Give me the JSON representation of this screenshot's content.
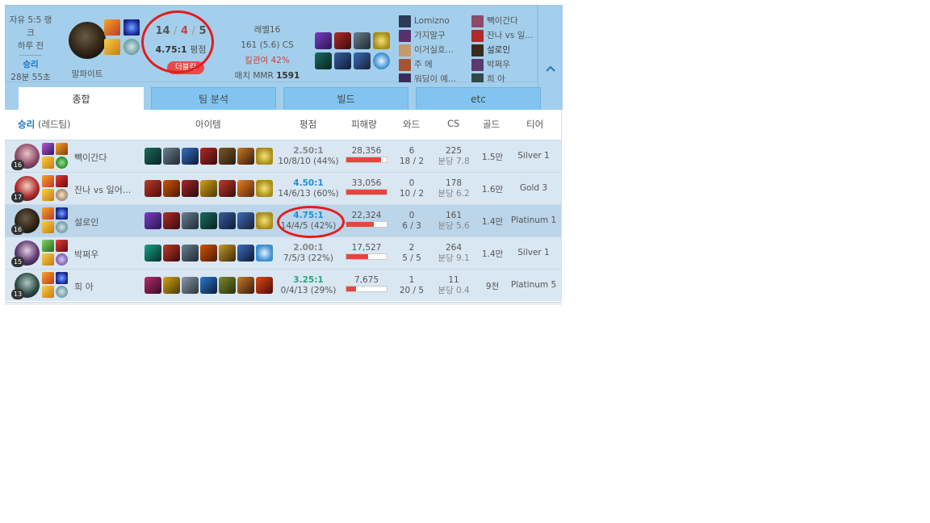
{
  "summary": {
    "queue": "자유 5:5 랭크",
    "time_ago": "하루 전",
    "result": "승리",
    "duration": "28분 55초",
    "champion": "말파이트",
    "kills": "14",
    "deaths": "4",
    "assists": "5",
    "kda_sep": "/",
    "ratio": "4.75:1",
    "ratio_suffix": "평점",
    "multikill": "더블킬",
    "level": "레벨16",
    "cs": "161 (5.6) CS",
    "kill_participation": "킬관여 42%",
    "mmr_label": "매치 MMR",
    "mmr_value": "1591"
  },
  "players_left": [
    {
      "name": "Lomizno"
    },
    {
      "name": "가지말구"
    },
    {
      "name": "이거실호..."
    },
    {
      "name": "주 에"
    },
    {
      "name": "워딩이 예..."
    }
  ],
  "players_right": [
    {
      "name": "빽이간다"
    },
    {
      "name": "잔나 vs 일..."
    },
    {
      "name": "설로인"
    },
    {
      "name": "박쩌우"
    },
    {
      "name": "희 아"
    }
  ],
  "tabs": [
    {
      "label": "종합"
    },
    {
      "label": "팀 분석"
    },
    {
      "label": "빌드"
    },
    {
      "label": "etc"
    }
  ],
  "table": {
    "team_result": "승리",
    "team_side": "(레드팀)",
    "headers": {
      "items": "아이템",
      "rating": "평점",
      "damage": "피해량",
      "ward": "와드",
      "cs": "CS",
      "gold": "골드",
      "tier": "티어"
    },
    "rows": [
      {
        "level": "16",
        "name": "빽이간다",
        "ratio": "2.50:1",
        "kda": "10/8/10 (44%)",
        "damage": "28,356",
        "damage_fraction": 0.86,
        "ward1": "6",
        "ward2": "18 / 2",
        "cs": "225",
        "cs_min": "분당 7.8",
        "gold": "1.5만",
        "tier": "Silver 1"
      },
      {
        "level": "17",
        "name": "잔나 vs 일어...",
        "ratio": "4.50:1",
        "kda": "14/6/13 (60%)",
        "damage": "33,056",
        "damage_fraction": 1.0,
        "ward1": "0",
        "ward2": "10 / 2",
        "cs": "178",
        "cs_min": "분당 6.2",
        "gold": "1.6만",
        "tier": "Gold 3"
      },
      {
        "level": "16",
        "name": "설로인",
        "ratio": "4.75:1",
        "kda": "14/4/5 (42%)",
        "damage": "22,324",
        "damage_fraction": 0.68,
        "ward1": "0",
        "ward2": "6 / 3",
        "cs": "161",
        "cs_min": "분당 5.6",
        "gold": "1.4만",
        "tier": "Platinum 1"
      },
      {
        "level": "15",
        "name": "박쩌우",
        "ratio": "2.00:1",
        "kda": "7/5/3 (22%)",
        "damage": "17,527",
        "damage_fraction": 0.53,
        "ward1": "2",
        "ward2": "5 / 5",
        "cs": "264",
        "cs_min": "분당 9.1",
        "gold": "1.4만",
        "tier": "Silver 1"
      },
      {
        "level": "13",
        "name": "희 아",
        "ratio": "3.25:1",
        "kda": "0/4/13 (29%)",
        "damage": "7,675",
        "damage_fraction": 0.23,
        "ward1": "1",
        "ward2": "20 / 5",
        "cs": "11",
        "cs_min": "분당 0.4",
        "gold": "9천",
        "tier": "Platinum 5"
      }
    ]
  },
  "colors": {
    "win_blue": "#1a78c2",
    "death_red": "#c6443e",
    "annotation_red": "#e41c1c",
    "panel_bg": "#a3cfec",
    "row_bg": "#d9e7f3",
    "row_me_bg": "#bcd5e9",
    "damage_bar": "#e5463f"
  }
}
